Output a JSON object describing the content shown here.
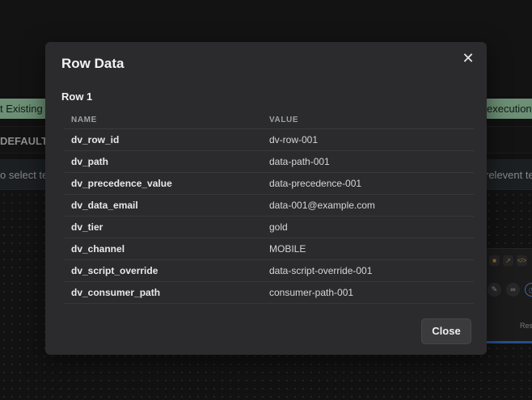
{
  "background": {
    "chip_left": "t Existing A",
    "chip_right": "execution P",
    "row_text": "DEFAULT",
    "banner_left": "o select te",
    "banner_right": "relevent te",
    "node_text": "Resp",
    "accent_green": "#a6dcb4",
    "accent_blue": "#3a7bd5"
  },
  "modal": {
    "title": "Row Data",
    "close_icon": "close-icon",
    "section_title": "Row 1",
    "columns": {
      "name": "NAME",
      "value": "VALUE"
    },
    "rows": [
      {
        "name": "dv_row_id",
        "value": "dv-row-001"
      },
      {
        "name": "dv_path",
        "value": "data-path-001"
      },
      {
        "name": "dv_precedence_value",
        "value": "data-precedence-001"
      },
      {
        "name": "dv_data_email",
        "value": "data-001@example.com"
      },
      {
        "name": "dv_tier",
        "value": "gold"
      },
      {
        "name": "dv_channel",
        "value": "MOBILE"
      },
      {
        "name": "dv_script_override",
        "value": "data-script-override-001"
      },
      {
        "name": "dv_consumer_path",
        "value": "consumer-path-001"
      }
    ],
    "close_label": "Close"
  }
}
